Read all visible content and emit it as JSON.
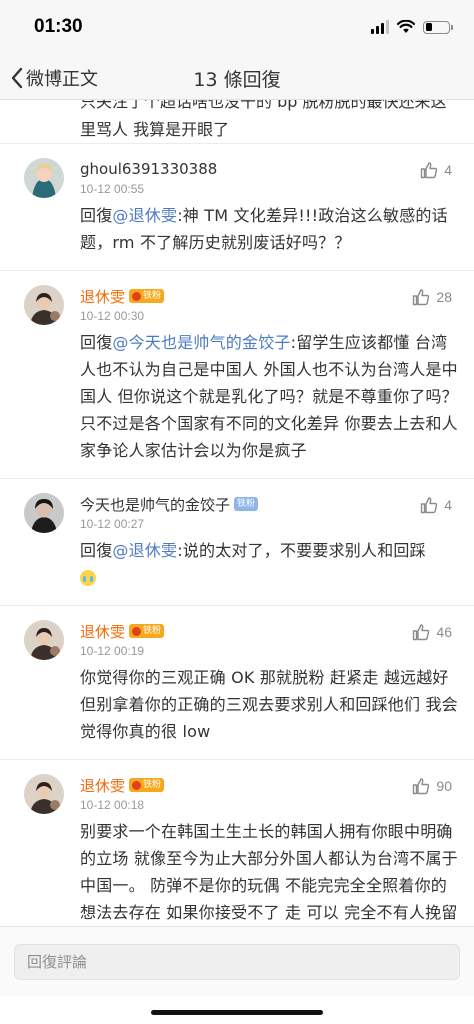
{
  "status_bar": {
    "time": "01:30",
    "battery_percent": 30
  },
  "nav": {
    "back_label": "微博正文",
    "title": "13 條回復"
  },
  "partial_comment": {
    "text": "只关注了个超话啥也没干的 bp 脱粉脱的最快还来这里骂人 我算是开眼了"
  },
  "comments": [
    {
      "user": "ghoul6391330388",
      "time": "10-12 00:55",
      "likes": "4",
      "parts": [
        {
          "text": "回復"
        },
        {
          "text": "@退休雯",
          "mention": true
        },
        {
          "text": ":神 TM 文化差异!!!政治这么敏感的话题，rm 不了解历史就别废话好吗？？"
        }
      ]
    },
    {
      "user": "退休雯",
      "badge": "铁粉",
      "time": "10-12 00:30",
      "likes": "28",
      "parts": [
        {
          "text": "回復"
        },
        {
          "text": "@今天也是帅气的金饺子",
          "mention": true
        },
        {
          "text": ":留学生应该都懂 台湾人也不认为自己是中国人 外国人也不认为台湾人是中国人 但你说这个就是乳化了吗？就是不尊重你了吗？只不过是各个国家有不同的文化差异 你要去上去和人家争论人家估计会以为你是疯子"
        }
      ]
    },
    {
      "user": "今天也是帅气的金饺子",
      "badge": "铁粉",
      "time": "10-12 00:27",
      "likes": "4",
      "parts": [
        {
          "text": "回復"
        },
        {
          "text": "@退休雯",
          "mention": true
        },
        {
          "text": ":说的太对了，不要要求别人和回踩"
        }
      ],
      "trailing_emoji": "cry-emoji"
    },
    {
      "user": "退休雯",
      "badge": "铁粉",
      "time": "10-12 00:19",
      "likes": "46",
      "parts": [
        {
          "text": "你觉得你的三观正确 OK 那就脱粉 赶紧走 越远越好 但别拿着你的正确的三观去要求别人和回踩他们 我会觉得你真的很 low"
        }
      ]
    },
    {
      "user": "退休雯",
      "badge": "铁粉",
      "time": "10-12 00:18",
      "likes": "90",
      "parts": [
        {
          "text": "别要求一个在韩国土生土长的韩国人拥有你眼中明确的立场 就像至今为止大部分外国人都认为台湾不属于中国一。 防弹不是你的玩偶 不能完完全全照着你的想法去存在 如果你接受不了 走 可以 完全不有人挽留你 但请记住 他们本质上也并没有做错什么 （我本人也不接受什么国家面前无爱豆这种话哈 管好你自己"
        }
      ]
    }
  ],
  "reply_bar": {
    "placeholder": "回復評論"
  }
}
